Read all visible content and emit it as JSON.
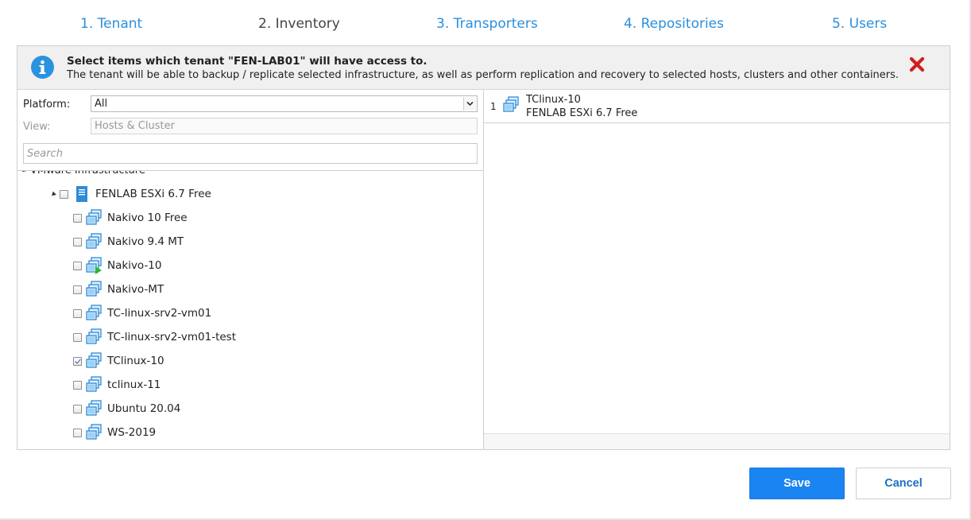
{
  "wizard": {
    "steps": [
      {
        "label": "1. Tenant",
        "state": "link"
      },
      {
        "label": "2. Inventory",
        "state": "active"
      },
      {
        "label": "3. Transporters",
        "state": "link"
      },
      {
        "label": "4. Repositories",
        "state": "link"
      },
      {
        "label": "5. Users",
        "state": "link"
      }
    ]
  },
  "banner": {
    "title": "Select items which tenant \"FEN-LAB01\" will have access to.",
    "description": "The tenant will be able to backup / replicate selected infrastructure, as well as perform replication and recovery to selected hosts, clusters and other containers.",
    "icon": "info-icon",
    "close_icon": "close-icon"
  },
  "filters": {
    "platform_label": "Platform:",
    "platform_value": "All",
    "view_label": "View:",
    "view_value": "Hosts & Cluster",
    "search_placeholder": "Search"
  },
  "tree": {
    "root_label": "VMware Infrastructure",
    "host": {
      "label": "FENLAB ESXi 6.7 Free",
      "checked": false,
      "expanded": true
    },
    "vms": [
      {
        "label": "Nakivo 10 Free",
        "checked": false,
        "running": false
      },
      {
        "label": "Nakivo 9.4 MT",
        "checked": false,
        "running": false
      },
      {
        "label": "Nakivo-10",
        "checked": false,
        "running": true
      },
      {
        "label": "Nakivo-MT",
        "checked": false,
        "running": false
      },
      {
        "label": "TC-linux-srv2-vm01",
        "checked": false,
        "running": false
      },
      {
        "label": "TC-linux-srv2-vm01-test",
        "checked": false,
        "running": false
      },
      {
        "label": "TClinux-10",
        "checked": true,
        "running": false
      },
      {
        "label": "tclinux-11",
        "checked": false,
        "running": false
      },
      {
        "label": "Ubuntu 20.04",
        "checked": false,
        "running": false
      },
      {
        "label": "WS-2019",
        "checked": false,
        "running": false
      }
    ]
  },
  "selected": [
    {
      "index": "1",
      "name": "TClinux-10",
      "location": "FENLAB ESXi 6.7 Free"
    }
  ],
  "buttons": {
    "save": "Save",
    "cancel": "Cancel"
  },
  "colors": {
    "accent": "#2b8fdc",
    "primary_button": "#1a84f0",
    "close": "#d0201c",
    "running": "#2fb830"
  }
}
